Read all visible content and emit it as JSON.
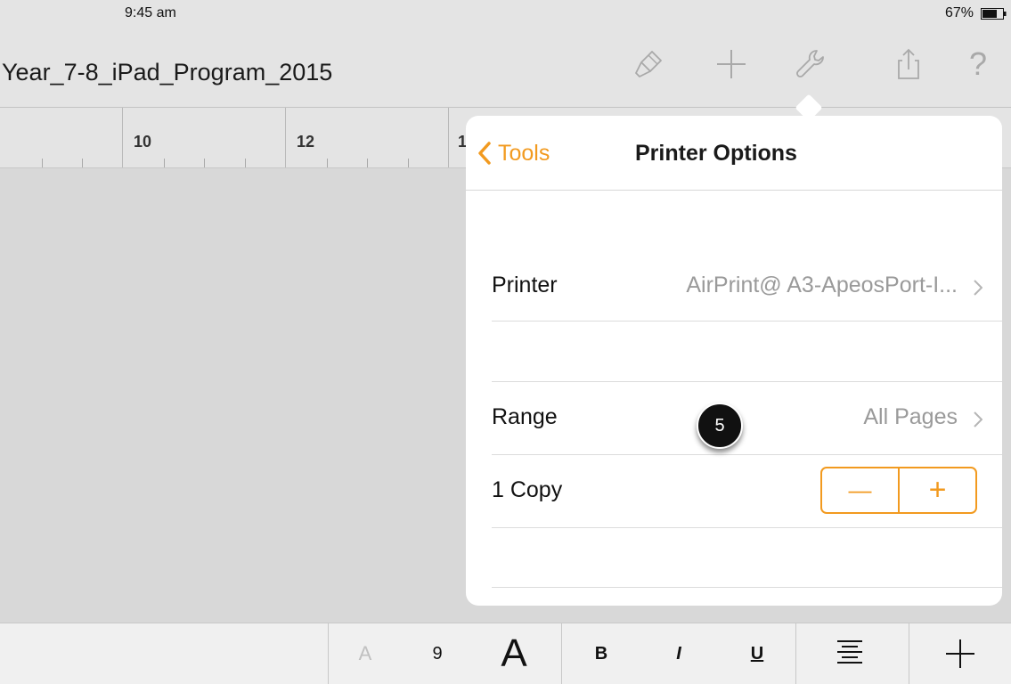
{
  "status_bar": {
    "time": "9:45 am",
    "battery": "67%"
  },
  "toolbar": {
    "document_title": "Year_7-8_iPad_Program_2015",
    "icons": [
      "paintbrush-icon",
      "plus-icon",
      "wrench-icon",
      "share-icon",
      "help-icon"
    ],
    "help_label": "?"
  },
  "ruler": {
    "labels": [
      "10",
      "12",
      "1"
    ]
  },
  "popover": {
    "back_label": "Tools",
    "title": "Printer Options",
    "printer": {
      "label": "Printer",
      "value": "AirPrint@ A3-ApeosPort-I..."
    },
    "range": {
      "label": "Range",
      "value": "All Pages"
    },
    "copies": {
      "label": "1 Copy",
      "decrement": "—",
      "increment": "+"
    }
  },
  "bottom_bar": {
    "font_small": "A",
    "font_size": "9",
    "font_large": "A",
    "bold": "B",
    "italic": "I",
    "underline": "U",
    "align_icon": "align-center-icon",
    "insert_icon": "plus-icon"
  },
  "callout": {
    "number": "5"
  },
  "colors": {
    "accent": "#f29a1f",
    "background": "#d8d8d8"
  }
}
